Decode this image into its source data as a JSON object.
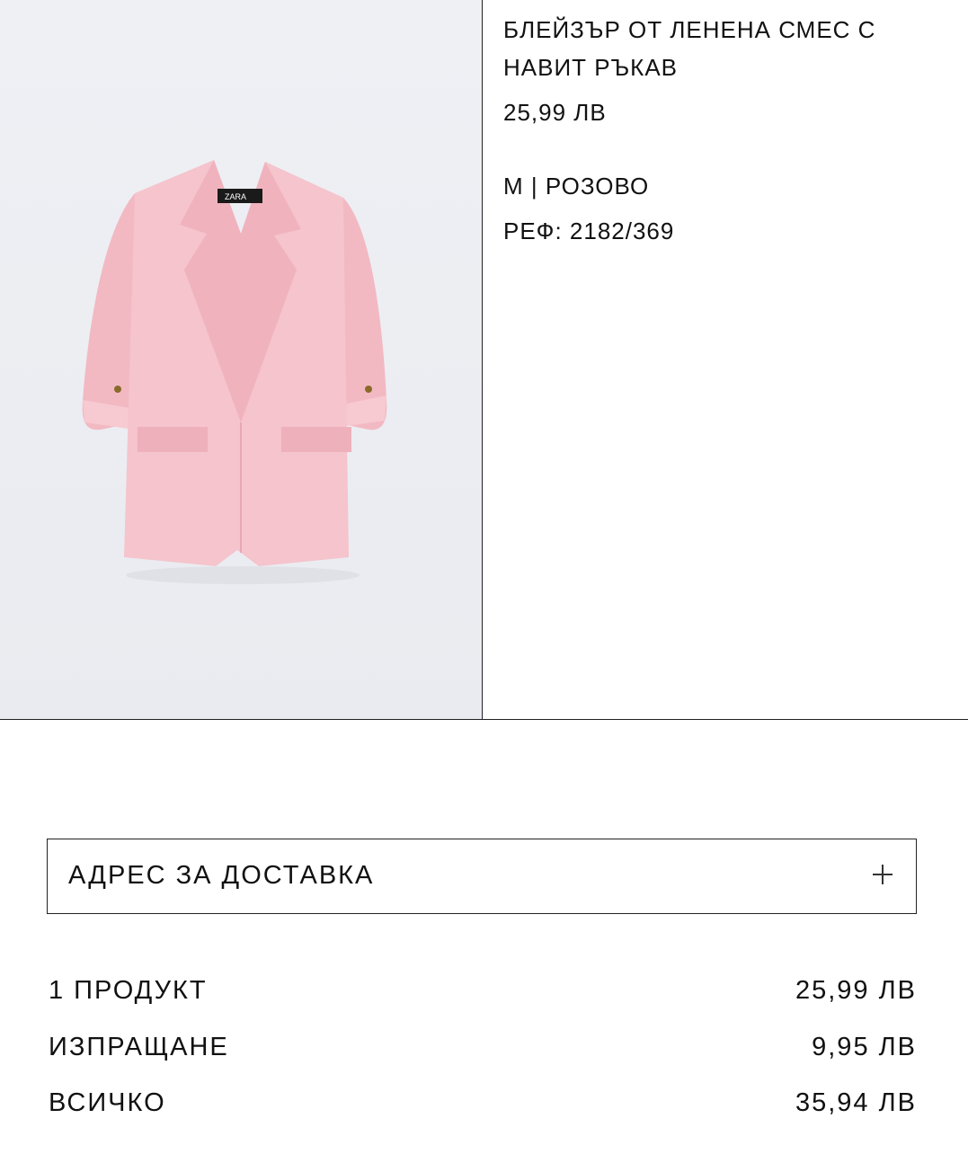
{
  "product": {
    "title_line1": "БЛЕЙЗЪР ОТ ЛЕНЕНА СМЕС С",
    "title_line2": "НАВИТ РЪКАВ",
    "price": "25,99 ЛВ",
    "variant": "M | РОЗОВО",
    "ref": "РЕФ: 2182/369",
    "image_label": "ZARA",
    "color": "#f5c4cc"
  },
  "delivery": {
    "label": "АДРЕС ЗА ДОСТАВКА",
    "expand_icon": "plus-icon"
  },
  "summary": {
    "products_label": "1 ПРОДУКТ",
    "products_value": "25,99 ЛВ",
    "shipping_label": "ИЗПРАЩАНЕ",
    "shipping_value": "9,95 ЛВ",
    "total_label": "ВСИЧКО",
    "total_value": "35,94 ЛВ"
  }
}
